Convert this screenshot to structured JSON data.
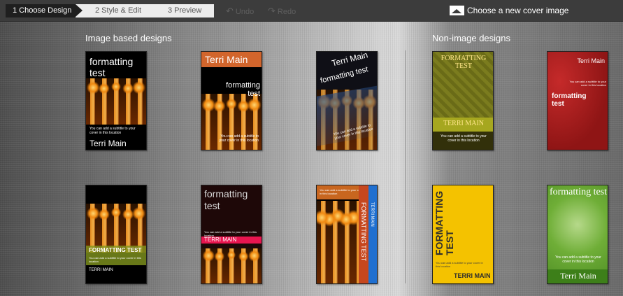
{
  "steps": [
    {
      "label": "1 Choose Design"
    },
    {
      "label": "2 Style & Edit"
    },
    {
      "label": "3 Preview"
    }
  ],
  "history": {
    "undo": "Undo",
    "redo": "Redo"
  },
  "choose_cover": "Choose a new cover image",
  "sections": {
    "image_based": "Image based designs",
    "non_image": "Non-image designs"
  },
  "covers": [
    {
      "title": "formatting test",
      "author": "Terri Main",
      "subtitle": "You can add a subtitle to your cover in this location"
    },
    {
      "title": "formatting test",
      "author": "Terri Main",
      "subtitle": "You can add a subtitle to your cover in this location"
    },
    {
      "title": "formatting test",
      "author": "Terri Main",
      "subtitle": "You can add a subtitle to your cover in this location"
    },
    {
      "title": "FORMATTING TEST",
      "author": "TERRI MAIN",
      "subtitle": "You can add a subtitle to your cover in this location"
    },
    {
      "title": "formatting test",
      "author": "Terri Main",
      "subtitle": "You can add a subtitle to your cover in this location"
    },
    {
      "title": "FORMATTING TEST",
      "author": "TERRI MAIN",
      "subtitle": "You can add a subtitle to your cover in this location"
    },
    {
      "title": "formatting test",
      "author": "TERRI MAIN",
      "subtitle": "You can add a subtitle to your cover in this location"
    },
    {
      "title": "FORMATTING TEST",
      "author": "TERRI MAIN",
      "subtitle": "You can add a subtitle to your cover in this location"
    },
    {
      "title": "FORMATTING TEST",
      "author": "TERRI MAIN",
      "subtitle": "You can add a subtitle to your cover in this location"
    },
    {
      "title": "formatting test",
      "author": "Terri Main",
      "subtitle": "You can add a subtitle to your cover in this location"
    }
  ],
  "icons": {
    "undo": "undo-icon",
    "redo": "redo-icon",
    "image": "image-icon"
  },
  "colors": {
    "topbar": "#3c3c3c",
    "active_step": "#1f1f1f",
    "inactive_step": "#ececec"
  }
}
